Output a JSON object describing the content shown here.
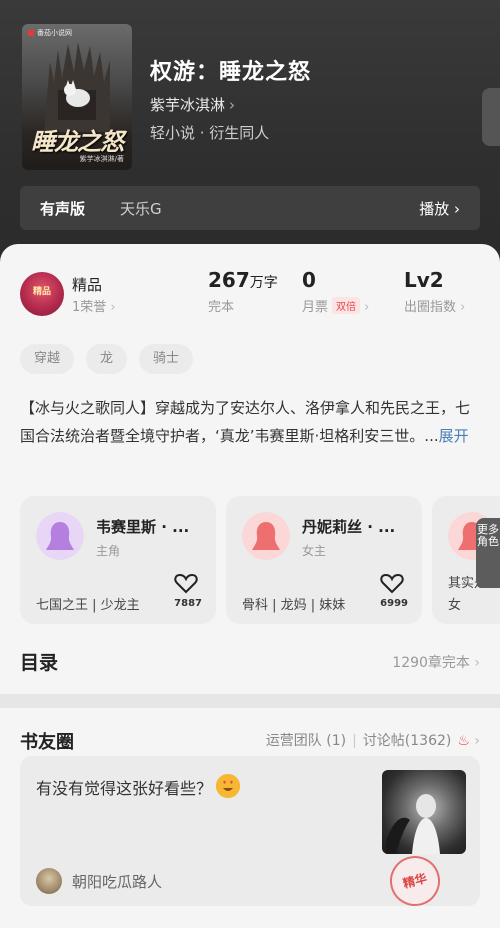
{
  "book": {
    "cover_publisher": "番茄小说网",
    "cover_title": "睡龙之怒",
    "cover_author": "紫芋冰淇淋/著",
    "title": "权游：睡龙之怒",
    "author": "紫芋冰淇淋",
    "genre": "轻小说 · 衍生同人"
  },
  "audio": {
    "badge": "有声版",
    "narrator": "天乐G",
    "play_label": "播放"
  },
  "stats": {
    "honor_label": "精品",
    "honor_sub": "1荣誉",
    "honor_badge_text": "精品",
    "words_value": "267",
    "words_unit": "万字",
    "words_sub": "完本",
    "ticket_value": "0",
    "ticket_sub": "月票",
    "ticket_badge": "双倍",
    "level_value": "Lv2",
    "level_sub": "出圈指数"
  },
  "tags": [
    "穿越",
    "龙",
    "骑士"
  ],
  "intro": {
    "text": "【冰与火之歌同人】穿越成为了安达尔人、洛伊拿人和先民之王，七国合法统治者暨全境守护者，‘真龙’韦赛里斯·坦格利安三世。...",
    "more": "展开"
  },
  "characters": [
    {
      "name": "韦赛里斯 · ...",
      "role": "主角",
      "desc": "七国之王 | 少龙主",
      "likes": "7887",
      "color": "#b57fe0"
    },
    {
      "name": "丹妮莉丝 · ...",
      "role": "女主",
      "desc": "骨科 | 龙妈 | 妹妹",
      "likes": "6999",
      "color": "#ee6f6f"
    },
    {
      "name": "",
      "role": "",
      "desc": "其实是",
      "desc2": "女",
      "likes": "",
      "color": "#ee6f6f"
    }
  ],
  "side_tab": "更多角色",
  "toc": {
    "label": "目录",
    "value": "1290章完本"
  },
  "community": {
    "title": "书友圈",
    "link_ops": "运营团队 (1)",
    "link_posts": "讨论帖(1362)",
    "post": {
      "text": "有没有觉得这张好看些？",
      "stamp": "精华",
      "user": "朝阳吃瓜路人"
    }
  }
}
